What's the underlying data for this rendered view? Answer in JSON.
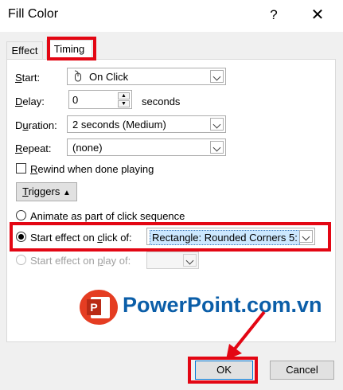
{
  "window": {
    "title": "Fill Color",
    "help_glyph": "?",
    "close_glyph": "✕"
  },
  "tabs": [
    {
      "label": "Effect",
      "selected": false
    },
    {
      "label": "Timing",
      "selected": true
    }
  ],
  "timing": {
    "start": {
      "label_key": "S",
      "label_rest": "tart:",
      "value": "On Click"
    },
    "delay": {
      "label_key": "D",
      "label_rest": "elay:",
      "value": "0",
      "unit": "seconds"
    },
    "duration": {
      "label_pre": "D",
      "label_key": "u",
      "label_rest": "ration:",
      "value": "2 seconds (Medium)"
    },
    "repeat": {
      "label_key": "R",
      "label_rest": "epeat:",
      "value": "(none)"
    },
    "rewind": {
      "label_pre": "",
      "label_key": "R",
      "label_rest": "ewind when done playing",
      "checked": false
    },
    "triggers_button": {
      "label_key": "T",
      "label_rest": "riggers"
    },
    "radio_sequence": {
      "label": "Animate as part of click sequence",
      "checked": false
    },
    "radio_click": {
      "label_pre": "Start effect on ",
      "label_key": "c",
      "label_rest": "lick of:",
      "value": "Rectangle: Rounded Corners 5:",
      "checked": true
    },
    "radio_play": {
      "label_pre": "Start effect on ",
      "label_key": "p",
      "label_rest": "lay of:",
      "checked": false,
      "disabled": true
    }
  },
  "watermark": {
    "text": "PowerPoint.com.vn",
    "icon_letter": "P"
  },
  "buttons": {
    "ok": "OK",
    "cancel": "Cancel"
  },
  "colors": {
    "highlight": "#e30613",
    "logo_blue": "#0b5ea8",
    "logo_red": "#e53d22"
  }
}
